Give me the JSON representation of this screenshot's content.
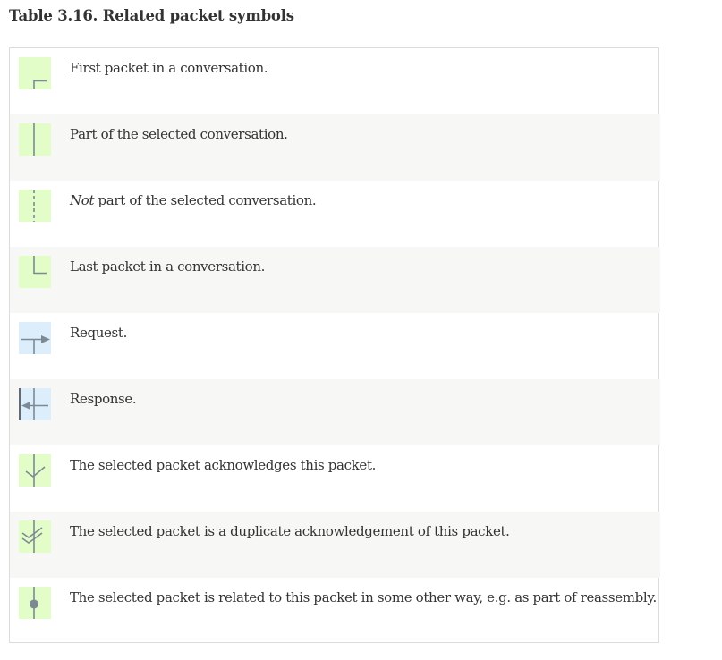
{
  "caption": "Table 3.16. Related packet symbols",
  "colors": {
    "conversation_bg": "#e2fdc8",
    "request_response_bg": "#dcedfb",
    "symbol_stroke": "#7d8a93",
    "alt_row_bg": "#f7f7f5"
  },
  "rows": [
    {
      "icon": "first-packet-icon",
      "text": "First packet in a conversation."
    },
    {
      "icon": "selected-conversation-icon",
      "text": "Part of the selected conversation."
    },
    {
      "icon": "not-selected-conversation-icon",
      "emphasis": "Not",
      "text": " part of the selected conversation."
    },
    {
      "icon": "last-packet-icon",
      "text": "Last packet in a conversation."
    },
    {
      "icon": "request-icon",
      "text": "Request."
    },
    {
      "icon": "response-icon",
      "text": "Response."
    },
    {
      "icon": "ack-icon",
      "text": "The selected packet acknowledges this packet."
    },
    {
      "icon": "duplicate-ack-icon",
      "text": "The selected packet is a duplicate acknowledgement of this packet."
    },
    {
      "icon": "related-other-icon",
      "text": "The selected packet is related to this packet in some other way, e.g. as part of reassembly."
    }
  ]
}
